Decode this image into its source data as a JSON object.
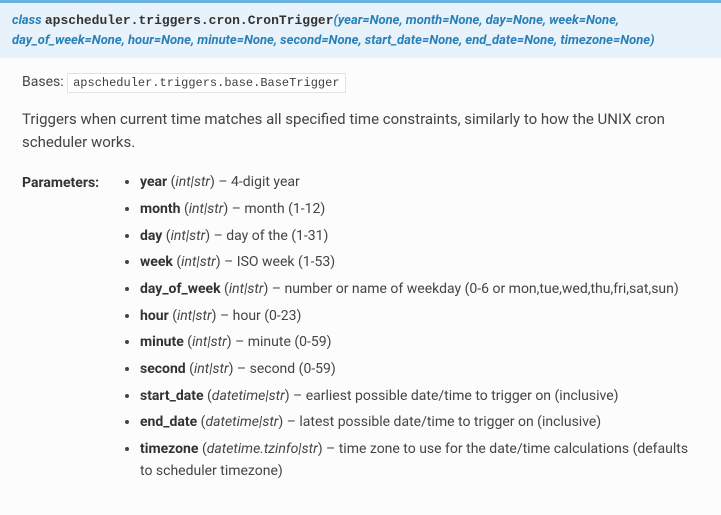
{
  "header": {
    "keyword": "class",
    "qualname": "apscheduler.triggers.cron.CronTrigger",
    "signature": "(year=None, month=None, day=None, week=None, day_of_week=None, hour=None, minute=None, second=None, start_date=None, end_date=None, timezone=None)"
  },
  "bases": {
    "label": "Bases:",
    "value": "apscheduler.triggers.base.BaseTrigger"
  },
  "description": "Triggers when current time matches all specified time constraints, similarly to how the UNIX cron scheduler works.",
  "params_label": "Parameters:",
  "params": [
    {
      "name": "year",
      "type": "int|str",
      "desc": "4-digit year"
    },
    {
      "name": "month",
      "type": "int|str",
      "desc": "month (1-12)"
    },
    {
      "name": "day",
      "type": "int|str",
      "desc": "day of the (1-31)"
    },
    {
      "name": "week",
      "type": "int|str",
      "desc": "ISO week (1-53)"
    },
    {
      "name": "day_of_week",
      "type": "int|str",
      "desc": "number or name of weekday (0-6 or mon,tue,wed,thu,fri,sat,sun)"
    },
    {
      "name": "hour",
      "type": "int|str",
      "desc": "hour (0-23)"
    },
    {
      "name": "minute",
      "type": "int|str",
      "desc": "minute (0-59)"
    },
    {
      "name": "second",
      "type": "int|str",
      "desc": "second (0-59)"
    },
    {
      "name": "start_date",
      "type": "datetime|str",
      "desc": "earliest possible date/time to trigger on (inclusive)"
    },
    {
      "name": "end_date",
      "type": "datetime|str",
      "desc": "latest possible date/time to trigger on (inclusive)"
    },
    {
      "name": "timezone",
      "type": "datetime.tzinfo|str",
      "desc": "time zone to use for the date/time calculations (defaults to scheduler timezone)"
    }
  ]
}
